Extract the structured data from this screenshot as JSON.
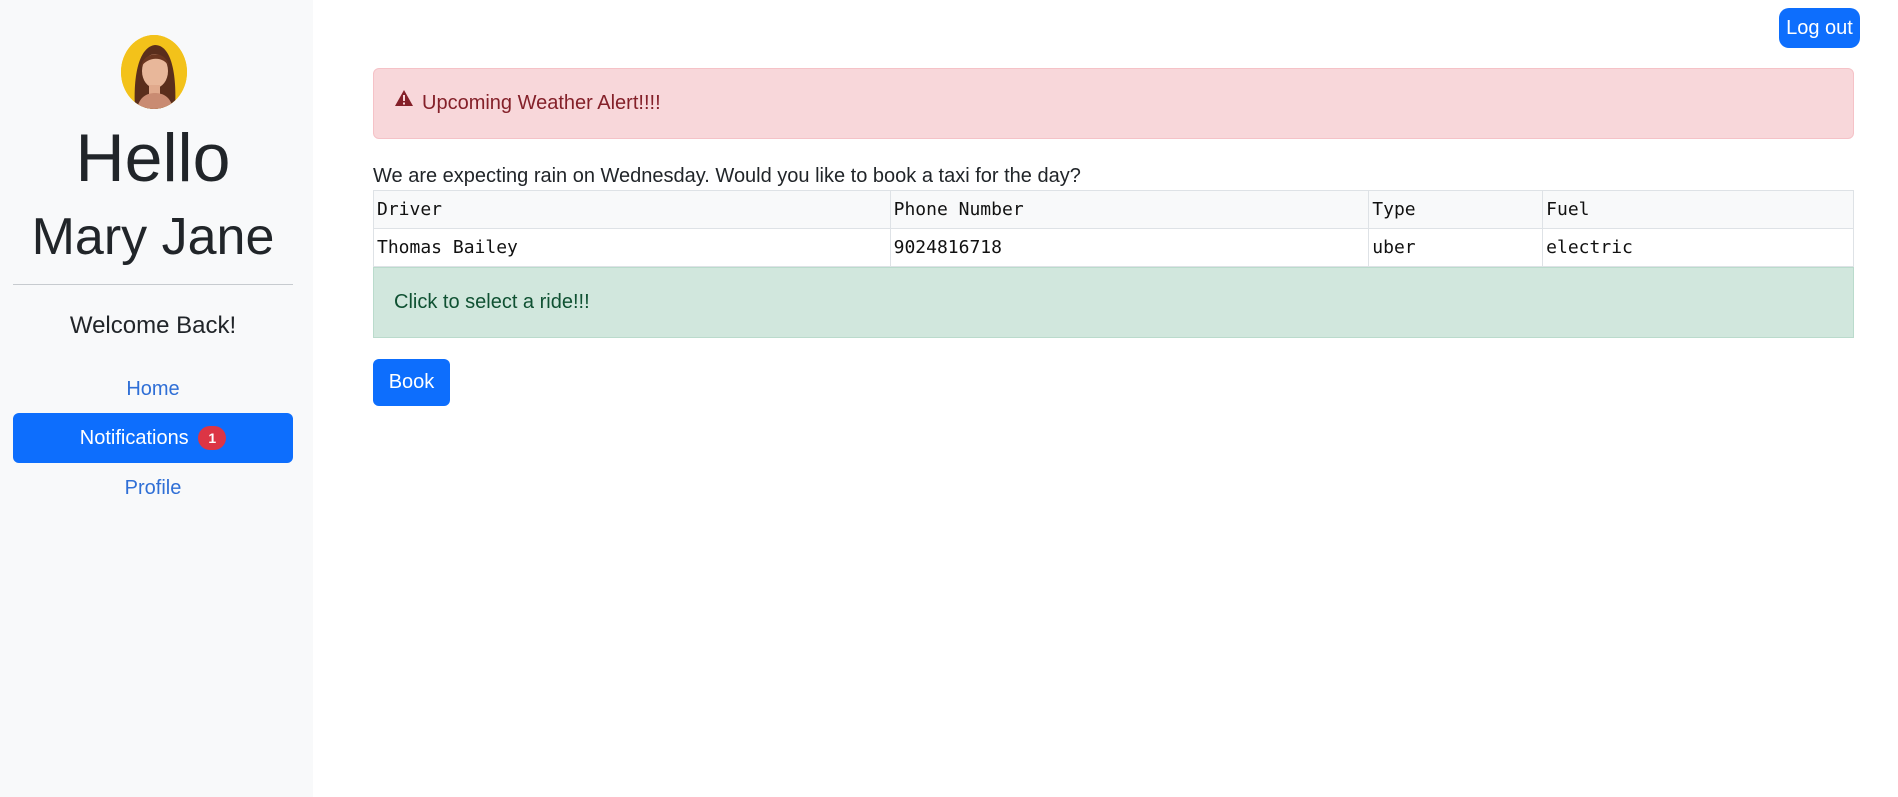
{
  "sidebar": {
    "greeting": "Hello",
    "user_name": "Mary Jane",
    "welcome": "Welcome Back!",
    "nav": {
      "home": "Home",
      "notifications": "Notifications",
      "notifications_count": "1",
      "profile": "Profile"
    }
  },
  "header": {
    "logout_label": "Log out"
  },
  "alert": {
    "icon": "warning-triangle-icon",
    "text": "Upcoming Weather Alert!!!!"
  },
  "message": "We are expecting rain on Wednesday. Would you like to book a taxi for the day?",
  "rides_table": {
    "columns": [
      "Driver",
      "Phone Number",
      "Type",
      "Fuel"
    ],
    "rows": [
      [
        "Thomas Bailey",
        "9024816718",
        "uber",
        "electric"
      ]
    ]
  },
  "select_hint": "Click to select a ride!!!",
  "book_label": "Book",
  "colors": {
    "primary": "#0d6efd",
    "danger_bg": "#f8d7da",
    "danger_text": "#842029",
    "success_bg": "#d1e7dd",
    "success_text": "#0f5132",
    "badge": "#dc3545",
    "avatar_bg": "#f3c21a"
  }
}
